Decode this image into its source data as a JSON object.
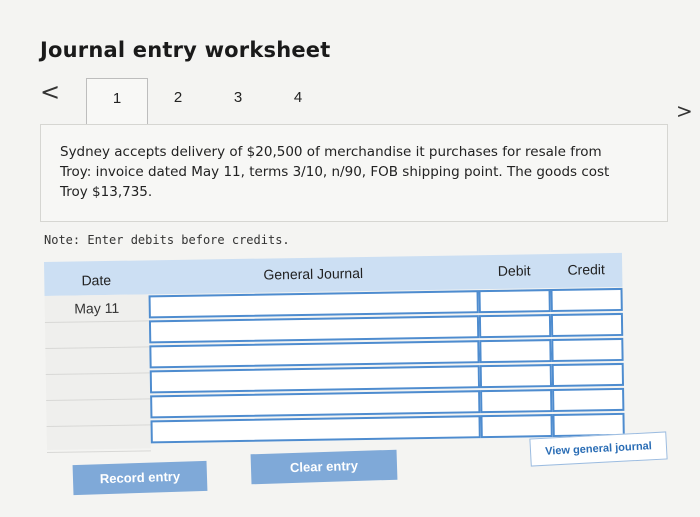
{
  "header": {
    "title": "Journal entry worksheet",
    "prev_glyph": "<",
    "next_glyph": ">"
  },
  "tabs": [
    {
      "label": "1",
      "active": true
    },
    {
      "label": "2",
      "active": false
    },
    {
      "label": "3",
      "active": false
    },
    {
      "label": "4",
      "active": false
    }
  ],
  "problem": {
    "text": "Sydney accepts delivery of $20,500 of merchandise it purchases for resale from Troy: invoice dated May 11, terms 3/10, n/90, FOB shipping point. The goods cost Troy $13,735."
  },
  "note": "Note: Enter debits before credits.",
  "journal": {
    "headers": {
      "date": "Date",
      "general_journal": "General Journal",
      "debit": "Debit",
      "credit": "Credit"
    },
    "rows": [
      {
        "date": "May 11",
        "account": "",
        "debit": "",
        "credit": ""
      },
      {
        "date": "",
        "account": "",
        "debit": "",
        "credit": ""
      },
      {
        "date": "",
        "account": "",
        "debit": "",
        "credit": ""
      },
      {
        "date": "",
        "account": "",
        "debit": "",
        "credit": ""
      },
      {
        "date": "",
        "account": "",
        "debit": "",
        "credit": ""
      },
      {
        "date": "",
        "account": "",
        "debit": "",
        "credit": ""
      }
    ]
  },
  "buttons": {
    "record": "Record entry",
    "clear": "Clear entry",
    "view": "View general journal"
  },
  "colors": {
    "header_bg": "#ccdff3",
    "input_border": "#4e8ccf",
    "button_bg": "#7fa9d8",
    "link_text": "#2a6db5"
  }
}
